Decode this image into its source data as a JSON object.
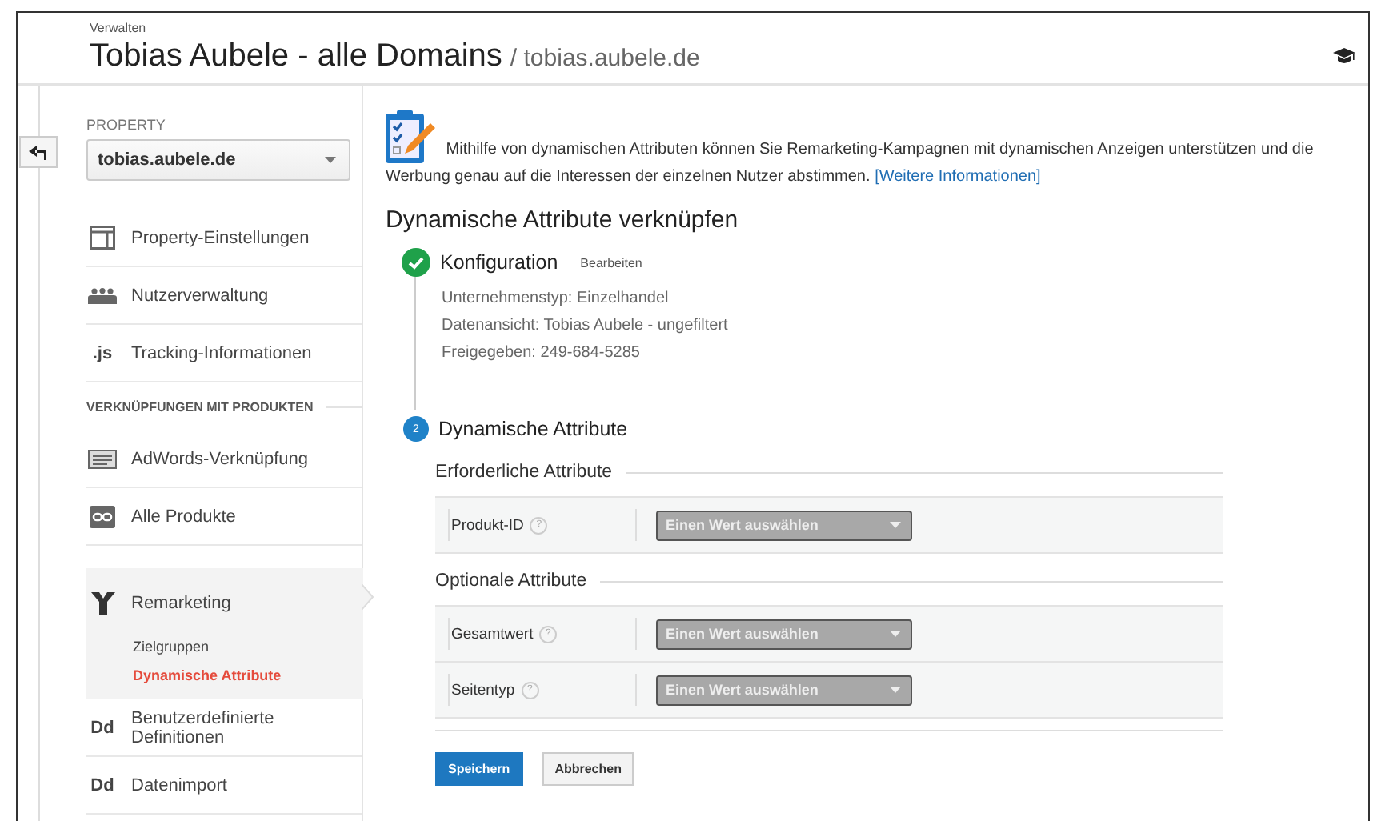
{
  "header": {
    "breadcrumb": "Verwalten",
    "title": "Tobias Aubele - alle Domains",
    "subtitle": "/ tobias.aubele.de"
  },
  "sidebar": {
    "property_label": "PROPERTY",
    "property_select": "tobias.aubele.de",
    "items": [
      {
        "kind": "link",
        "label": "Property-Einstellungen",
        "selected": false
      },
      {
        "kind": "link",
        "label": "Nutzerverwaltung",
        "selected": false
      },
      {
        "kind": "link",
        "label": "Tracking-Informationen",
        "glyph": ".js",
        "selected": false
      },
      {
        "kind": "heading",
        "label": "VERKNÜPFUNGEN MIT PRODUKTEN"
      },
      {
        "kind": "link",
        "label": "AdWords-Verknüpfung",
        "selected": false
      },
      {
        "kind": "link",
        "label": "Alle Produkte",
        "selected": false
      },
      {
        "kind": "link",
        "label": "Remarketing",
        "selected": true,
        "children": [
          {
            "label": "Zielgruppen",
            "selected": false
          },
          {
            "label": "Dynamische Attribute",
            "selected": true
          }
        ]
      },
      {
        "kind": "link",
        "label": "Benutzerdefinierte Definitionen",
        "glyph": "Dd",
        "selected": false
      },
      {
        "kind": "link",
        "label": "Datenimport",
        "glyph": "Dd",
        "selected": false
      }
    ]
  },
  "main": {
    "intro": {
      "text": "Mithilfe von dynamischen Attributen können Sie Remarketing-Kampagnen mit dynamischen Anzeigen unterstützen und die Werbung genau auf die Interessen der einzelnen Nutzer abstimmen.",
      "link": "[Weitere Informationen]"
    },
    "heading": "Dynamische Attribute verknüpfen",
    "steps": [
      {
        "done": true,
        "title": "Konfiguration",
        "action": "Bearbeiten",
        "details": [
          "Unternehmenstyp: Einzelhandel",
          "Datenansicht: Tobias Aubele - ungefiltert",
          "Freigegeben: 249-684-5285"
        ]
      },
      {
        "done": false,
        "number": "2",
        "title": "Dynamische Attribute",
        "sections": [
          {
            "title": "Erforderliche Attribute",
            "fields": [
              {
                "label": "Produkt-ID",
                "help": "?",
                "value": "Einen Wert auswählen"
              }
            ]
          },
          {
            "title": "Optionale Attribute",
            "fields": [
              {
                "label": "Gesamtwert",
                "help": "?",
                "value": "Einen Wert auswählen"
              },
              {
                "label": "Seitentyp",
                "help": "?",
                "value": "Einen Wert auswählen"
              }
            ]
          }
        ]
      }
    ],
    "buttons": [
      {
        "label": "Speichern",
        "kind": "primary"
      },
      {
        "label": "Abbrechen",
        "kind": "secondary"
      }
    ]
  }
}
